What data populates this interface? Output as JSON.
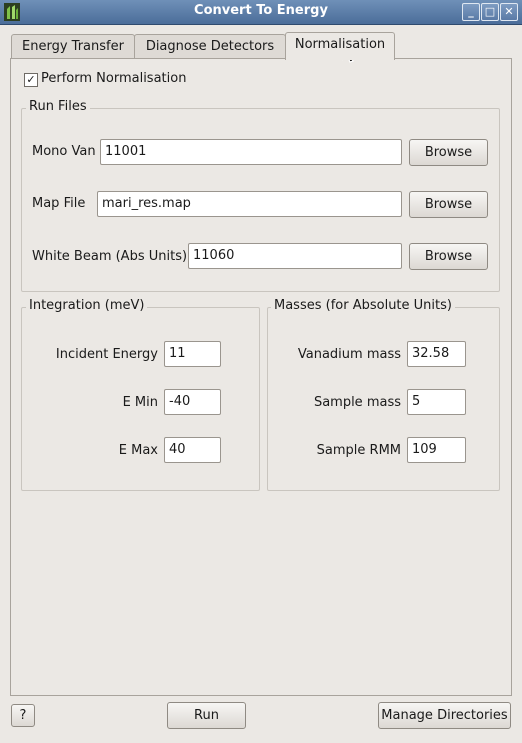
{
  "window": {
    "title": "Convert To Energy",
    "controls": {
      "minimize": "_",
      "maximize": "□",
      "close": "✕"
    }
  },
  "tabs": [
    {
      "label": "Energy Transfer"
    },
    {
      "label": "Diagnose Detectors"
    },
    {
      "label": "Normalisation",
      "active": true
    }
  ],
  "normalisation": {
    "perform_label": "Perform Normalisation",
    "perform_checked": "✓",
    "run_files": {
      "title": "Run Files",
      "mono_van": {
        "label": "Mono Van",
        "value": "11001",
        "button": "Browse"
      },
      "map_file": {
        "label": "Map File",
        "value": "mari_res.map",
        "button": "Browse"
      },
      "white_beam": {
        "label": "White Beam (Abs Units)",
        "value": "11060",
        "button": "Browse"
      }
    },
    "integration": {
      "title": "Integration (meV)",
      "incident_energy": {
        "label": "Incident Energy",
        "value": "11"
      },
      "e_min": {
        "label": "E Min",
        "value": "-40"
      },
      "e_max": {
        "label": "E Max",
        "value": "40"
      }
    },
    "masses": {
      "title": "Masses (for Absolute Units)",
      "vanadium_mass": {
        "label": "Vanadium mass",
        "value": "32.58"
      },
      "sample_mass": {
        "label": "Sample mass",
        "value": "5"
      },
      "sample_rmm": {
        "label": "Sample RMM",
        "value": "109"
      }
    }
  },
  "footer": {
    "help": "?",
    "run": "Run",
    "manage": "Manage Directories"
  }
}
